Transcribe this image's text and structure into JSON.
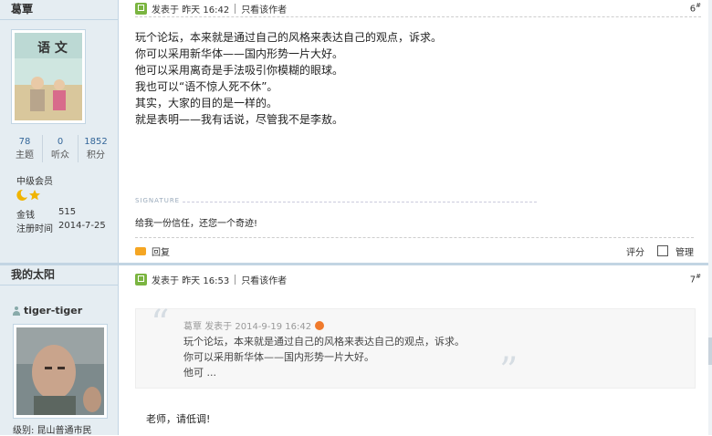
{
  "post6": {
    "author": "葛覃",
    "stats": [
      {
        "value": "78",
        "label": "主题"
      },
      {
        "value": "0",
        "label": "听众"
      },
      {
        "value": "1852",
        "label": "积分"
      }
    ],
    "rank": "中级会员",
    "info": [
      {
        "label": "金钱",
        "value": "515"
      },
      {
        "label": "注册时间",
        "value": "2014-7-25"
      }
    ],
    "posted_label": "发表于",
    "posted_time": "昨天 16:42",
    "only_author": "只看该作者",
    "floor": "6",
    "floor_suffix": "#",
    "content": [
      "玩个论坛，本来就是通过自己的风格来表达自己的观点，诉求。",
      "你可以采用新华体——国内形势一片大好。",
      "他可以采用离奇是手法吸引你模糊的眼球。",
      "我也可以“语不惊人死不休”。",
      "其实，大家的目的是一样的。",
      "就是表明——我有话说，尽管我不是李敖。"
    ],
    "signature_label": "SIGNATURE",
    "signature": "给我一份信任，还您一个奇迹!",
    "reply": "回复",
    "rate": "评分",
    "manage": "管理"
  },
  "post7": {
    "sidebar_title": "我的太阳",
    "author": "tiger-tiger",
    "rank_line": "级别: 昆山普通市民",
    "posted_label": "发表于",
    "posted_time": "昨天 16:53",
    "only_author": "只看该作者",
    "floor": "7",
    "floor_suffix": "#",
    "quote_author": "葛覃",
    "quote_posted": "发表于 2014-9-19 16:42",
    "quote_lines": [
      "玩个论坛，本来就是通过自己的风格来表达自己的观点，诉求。",
      "你可以采用新华体——国内形势一片大好。",
      "他可 ..."
    ],
    "reply_text": "老师，请低调!"
  },
  "colors": {
    "sidebar_bg": "#e5edf2",
    "border": "#c2d5e3",
    "link": "#336699",
    "post_icon": "#7bb541",
    "reply_icon": "#f5a623"
  }
}
